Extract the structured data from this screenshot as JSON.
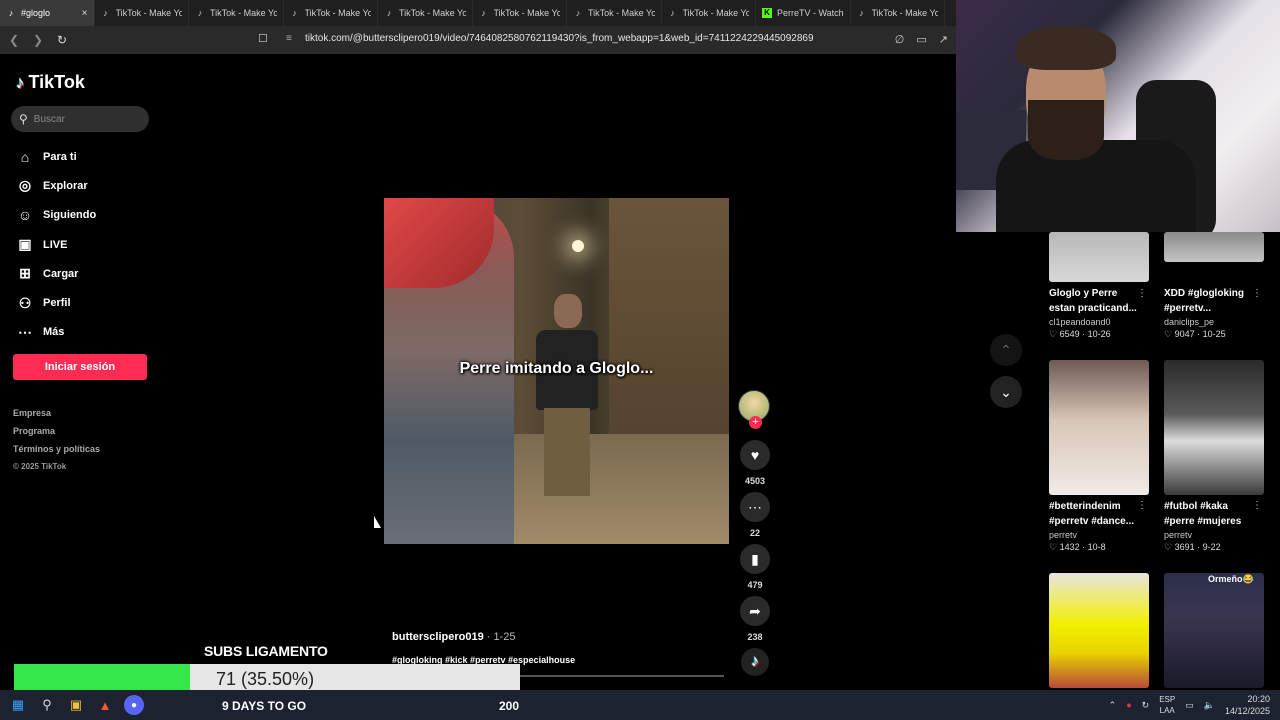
{
  "browser": {
    "tabs": [
      {
        "label": "#gloglo",
        "icon": "tiktok-icon",
        "active": true
      },
      {
        "label": "TikTok - Make Yo",
        "icon": "tiktok-icon"
      },
      {
        "label": "TikTok - Make Yo",
        "icon": "tiktok-icon"
      },
      {
        "label": "TikTok - Make Yo",
        "icon": "tiktok-icon"
      },
      {
        "label": "TikTok - Make Yo",
        "icon": "tiktok-icon"
      },
      {
        "label": "TikTok - Make Yo",
        "icon": "tiktok-icon"
      },
      {
        "label": "TikTok - Make Yo",
        "icon": "tiktok-icon"
      },
      {
        "label": "TikTok - Make Yo",
        "icon": "tiktok-icon"
      },
      {
        "label": "PerreTV - Watch",
        "icon": "kick-icon"
      },
      {
        "label": "TikTok - Make Yo",
        "icon": "tiktok-icon"
      }
    ],
    "url": "tiktok.com/@buttersclipero019/video/7464082580762119430?is_from_webapp=1&web_id=7411224229445092869"
  },
  "sidebar": {
    "logo": "TikTok",
    "search_placeholder": "Buscar",
    "nav": [
      {
        "label": "Para ti",
        "icon": "home-icon"
      },
      {
        "label": "Explorar",
        "icon": "compass-icon"
      },
      {
        "label": "Siguiendo",
        "icon": "following-icon"
      },
      {
        "label": "LIVE",
        "icon": "live-icon"
      },
      {
        "label": "Cargar",
        "icon": "upload-icon"
      },
      {
        "label": "Perfil",
        "icon": "profile-icon"
      },
      {
        "label": "Más",
        "icon": "more-icon"
      }
    ],
    "login_label": "Iniciar sesión",
    "footer_links": [
      "Empresa",
      "Programa",
      "Términos y políticas"
    ],
    "copyright": "© 2025 TikTok"
  },
  "video": {
    "caption_overlay": "Perre imitando a Gloglo...",
    "author": "buttersclipero019",
    "date": "1-25",
    "hashtags": "#glogloking #kick #perretv #especialhouse",
    "progress": 0.0
  },
  "actions": {
    "likes": "4503",
    "comments": "22",
    "saves": "479",
    "shares": "238"
  },
  "recommended": [
    {
      "title": "Gloglo y Perre estan practicand...",
      "author": "cl1peandoand0",
      "likes": "6549",
      "date": "10-26"
    },
    {
      "title": "XDD #glogloking #perretv...",
      "author": "daniclips_pe",
      "likes": "9047",
      "date": "10-25"
    },
    {
      "title": "#betterindenim #perretv #dance...",
      "author": "perretv",
      "likes": "1432",
      "date": "10-8"
    },
    {
      "title": "#futbol #kaka #perre #mujeres",
      "author": "perretv",
      "likes": "3691",
      "date": "9-22"
    },
    {
      "title": "",
      "author": "",
      "likes": "",
      "date": ""
    },
    {
      "title": "",
      "author": "",
      "likes": "",
      "date": ""
    }
  ],
  "thumb_text": {
    "ormeno": "Ormeño😂"
  },
  "overlay": {
    "subs_title": "SUBS LIGAMENTO",
    "subs_value": "71 (35.50%)",
    "subs_fraction": 0.355,
    "days_left": "9 DAYS TO GO",
    "goal": "200"
  },
  "taskbar": {
    "lang_top": "ESP",
    "lang_bottom": "LAA",
    "time": "20:20",
    "date": "14/12/2025"
  },
  "colors": {
    "accent": "#fe2c55",
    "progress_fill": "#33e64a"
  }
}
